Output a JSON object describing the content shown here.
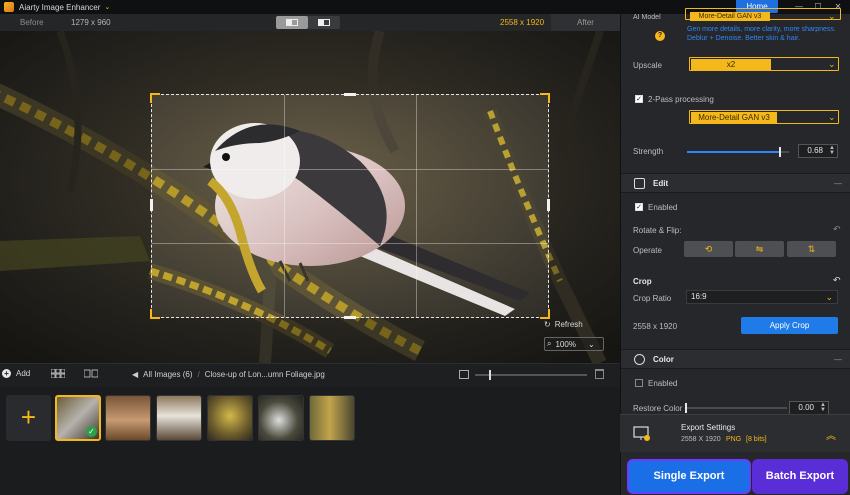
{
  "titlebar": {
    "app_title": "Aiarty Image Enhancer",
    "home": "Home",
    "minimize": "—",
    "maximize": "☐",
    "close": "✕"
  },
  "viewer": {
    "before_label": "Before",
    "before_res": "1279 x 960",
    "after_res": "2558 x 1920",
    "after_label": "After",
    "refresh": "Refresh",
    "zoom": "100%"
  },
  "strip": {
    "add_label": "Add",
    "all_images": "All Images (6)",
    "file_sep": "/",
    "file_name": "Close-up of Lon...umn Foliage.jpg"
  },
  "panel": {
    "ai_model_label": "AI Model",
    "ai_model_value": "More-Detail GAN v3",
    "ai_desc": [
      "Gen more details, more clarity, more sharpness.",
      "Deblur + Denoise. Better skin & hair."
    ],
    "upscale_label": "Upscale",
    "upscale_value": "x2",
    "twopass_label": "2-Pass processing",
    "twopass_value": "More-Detail GAN v3",
    "strength_label": "Strength",
    "strength_value": "0.68",
    "edit_title": "Edit",
    "enabled_label": "Enabled",
    "rotate_label": "Rotate & Flip:",
    "operate_label": "Operate",
    "crop_title": "Crop",
    "crop_ratio_label": "Crop Ratio",
    "crop_ratio_value": "16:9",
    "crop_res": "2558 x 1920",
    "apply_crop": "Apply Crop",
    "color_title": "Color",
    "color_enabled_label": "Enabled",
    "restore_label": "Restore Color",
    "restore_value": "0.00"
  },
  "export": {
    "title": "Export Settings",
    "res": "2558 X 1920",
    "format": "PNG",
    "bits": "[8 bits]",
    "single": "Single Export",
    "batch": "Batch Export"
  },
  "colors": {
    "accent": "#f5b81b",
    "blue": "#1f7be8",
    "purple": "#5a2ed6"
  },
  "levels": {
    "strength": 0.68,
    "zoom_slider": 0.13
  }
}
